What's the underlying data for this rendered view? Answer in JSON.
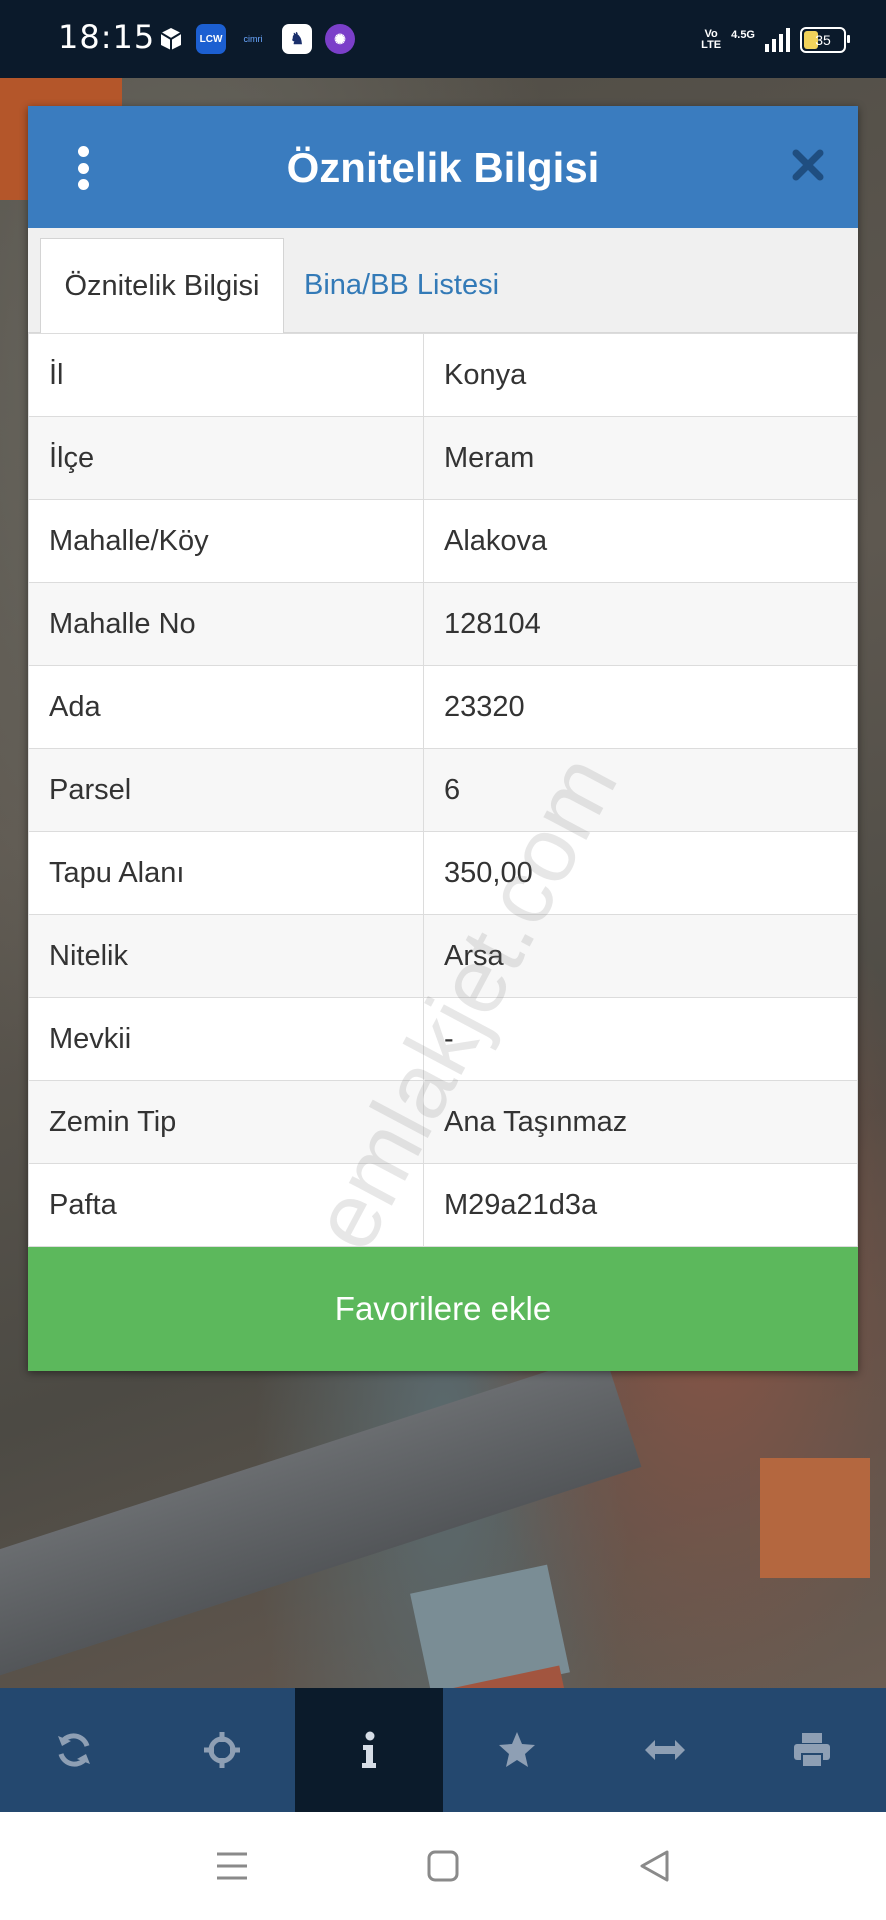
{
  "status_bar": {
    "time": "18:15",
    "app_icons": [
      "cube-icon",
      "lcw-icon",
      "cimri-icon",
      "polo-icon",
      "game-icon"
    ],
    "lcw_label": "LCW",
    "cimri_label": "cimri",
    "volte_label_1": "Vo",
    "volte_label_2": "LTE",
    "network_label": "4.5G",
    "battery_level": "35"
  },
  "dialog": {
    "title": "Öznitelik Bilgisi",
    "tabs": [
      {
        "label": "Öznitelik Bilgisi",
        "active": true
      },
      {
        "label": "Bina/BB Listesi",
        "active": false
      }
    ],
    "rows": [
      {
        "key": "İl",
        "value": "Konya"
      },
      {
        "key": "İlçe",
        "value": "Meram"
      },
      {
        "key": "Mahalle/Köy",
        "value": "Alakova"
      },
      {
        "key": "Mahalle No",
        "value": "128104"
      },
      {
        "key": "Ada",
        "value": "23320"
      },
      {
        "key": "Parsel",
        "value": "6"
      },
      {
        "key": "Tapu Alanı",
        "value": "350,00"
      },
      {
        "key": "Nitelik",
        "value": "Arsa"
      },
      {
        "key": "Mevkii",
        "value": "-"
      },
      {
        "key": "Zemin Tip",
        "value": "Ana Taşınmaz"
      },
      {
        "key": "Pafta",
        "value": "M29a21d3a"
      }
    ],
    "favorite_button": "Favorilere ekle"
  },
  "watermark": "emlakjet.com",
  "toolbar": {
    "items": [
      {
        "icon": "refresh-icon"
      },
      {
        "icon": "crosshair-icon"
      },
      {
        "icon": "info-icon",
        "active": true
      },
      {
        "icon": "star-icon"
      },
      {
        "icon": "measure-icon"
      },
      {
        "icon": "print-icon"
      }
    ]
  },
  "nav_bar": {
    "items": [
      "menu-icon",
      "home-icon",
      "back-icon"
    ]
  },
  "colors": {
    "header_blue": "#3a7cbf",
    "tab_link_blue": "#337ab7",
    "button_green": "#5cb85c",
    "toolbar_blue": "#24486f"
  }
}
